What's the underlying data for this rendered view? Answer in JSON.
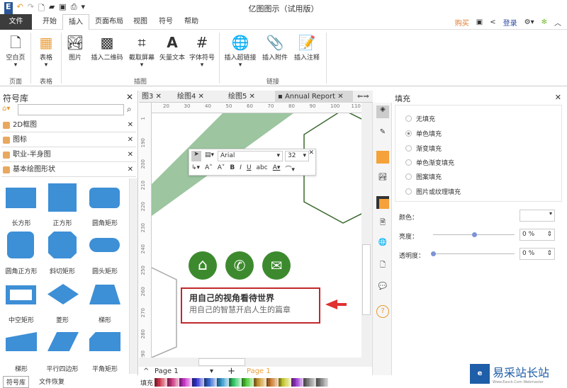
{
  "app": {
    "title": "亿图图示（试用版）"
  },
  "menu": {
    "tabs": [
      "文件",
      "开始",
      "插入",
      "页面布局",
      "视图",
      "符号",
      "帮助"
    ],
    "buy": "购买",
    "login": "登录"
  },
  "ribbon": {
    "buttons": [
      "空白页",
      "表格",
      "图片",
      "插入二维码",
      "截取屏幕",
      "矢量文本",
      "字体符号",
      "插入超链接",
      "插入附件",
      "插入注释"
    ],
    "groups": [
      "页面",
      "表格",
      "插图",
      "链接"
    ]
  },
  "library": {
    "title": "符号库",
    "search_placeholder": "",
    "categories": [
      "2D框图",
      "图标",
      "职业-半身图",
      "基本绘图形状"
    ],
    "shapes": [
      "长方形",
      "正方形",
      "圆角矩形",
      "圆角正方形",
      "斜切矩形",
      "圆头矩形",
      "中空矩形",
      "菱形",
      "梯形",
      "梯形",
      "平行四边形",
      "平角矩形"
    ],
    "bottom_tabs": [
      "符号库",
      "文件恢复"
    ]
  },
  "doc_tabs": [
    {
      "label": "图3"
    },
    {
      "label": "绘图4"
    },
    {
      "label": "绘图5"
    },
    {
      "label": "Annual Report",
      "active": true
    }
  ],
  "ruler": {
    "top": [
      "20",
      "30",
      "40",
      "50",
      "60",
      "70",
      "80",
      "90",
      "100",
      "110"
    ],
    "left": [
      "1",
      "190",
      "200",
      "210",
      "220",
      "230",
      "240",
      "250",
      "260",
      "270",
      "280",
      "290"
    ]
  },
  "text_toolbar": {
    "font": "Arial",
    "size": "32"
  },
  "canvas": {
    "line1": "用自己的视角看待世界",
    "line2": "用自己的智慧开启人生的篇章",
    "accent": "#3d8a2e",
    "box_border": "#c0282d"
  },
  "pages": {
    "current": "Page 1",
    "active_tab": "Page 1"
  },
  "fill_label": "填充",
  "fill_panel": {
    "title": "填充",
    "options": [
      "无填充",
      "单色填充",
      "渐变填充",
      "单色渐变填充",
      "图案填充",
      "图片或纹理填充"
    ],
    "selected": 1,
    "color_label": "颜色：",
    "brightness_label": "亮度：",
    "brightness_value": "0 %",
    "brightness_level": 0.5,
    "transparency_label": "透明度：",
    "transparency_value": "0 %",
    "transparency_level": 0
  },
  "watermark": {
    "text": "易采站长站",
    "sub": "Www.Easck.Com Webmaster"
  }
}
